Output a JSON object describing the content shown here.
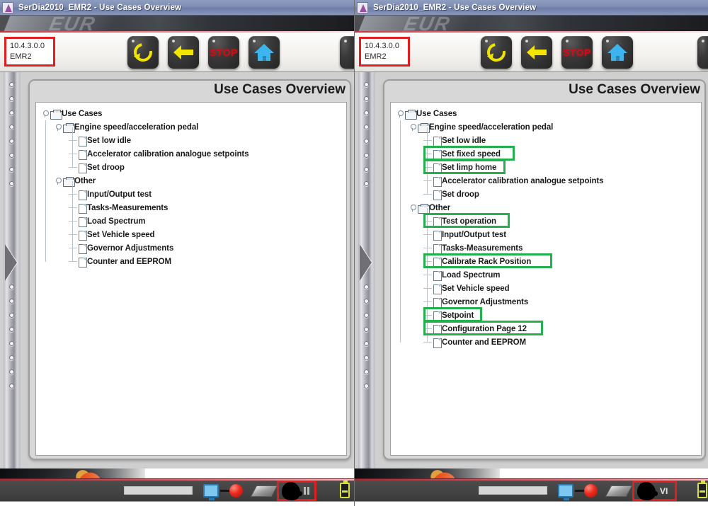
{
  "window": {
    "title": "SerDia2010_EMR2 - Use Cases Overview",
    "app_icon": "app-logo-icon",
    "banner_text": "EUR"
  },
  "toolbar": {
    "version_line1": "10.4.3.0.0",
    "version_line2": "EMR2",
    "version_box_accent": "#e02020",
    "buttons": [
      {
        "name": "refresh-button",
        "icon": "refresh-circular-arrow-icon",
        "label": ""
      },
      {
        "name": "back-button",
        "icon": "left-arrow-icon",
        "label": ""
      },
      {
        "name": "stop-button",
        "icon": "stop-icon",
        "label": "STOP"
      },
      {
        "name": "home-button",
        "icon": "home-icon",
        "label": ""
      }
    ]
  },
  "panel": {
    "heading": "Use Cases Overview",
    "heading_visible": "Use"
  },
  "tree_left": {
    "nodes": [
      {
        "level": 0,
        "type": "folder",
        "label": "Use Cases",
        "expanded": true,
        "highlighted": false
      },
      {
        "level": 1,
        "type": "folder",
        "label": "Engine speed/acceleration pedal",
        "expanded": true,
        "highlighted": false
      },
      {
        "level": 2,
        "type": "file",
        "label": "Set low idle",
        "highlighted": false
      },
      {
        "level": 2,
        "type": "file",
        "label": "Accelerator calibration analogue setpoints",
        "highlighted": false
      },
      {
        "level": 2,
        "type": "file",
        "label": "Set droop",
        "highlighted": false
      },
      {
        "level": 1,
        "type": "folder",
        "label": "Other",
        "expanded": true,
        "highlighted": false
      },
      {
        "level": 2,
        "type": "file",
        "label": "Input/Output test",
        "highlighted": false
      },
      {
        "level": 2,
        "type": "file",
        "label": "Tasks-Measurements",
        "highlighted": false
      },
      {
        "level": 2,
        "type": "file",
        "label": "Load Spectrum",
        "highlighted": false
      },
      {
        "level": 2,
        "type": "file",
        "label": "Set Vehicle speed",
        "highlighted": false
      },
      {
        "level": 2,
        "type": "file",
        "label": "Governor Adjustments",
        "highlighted": false
      },
      {
        "level": 2,
        "type": "file",
        "label": "Counter and EEPROM",
        "highlighted": false
      }
    ]
  },
  "tree_right": {
    "highlight_color": "#22b14c",
    "nodes": [
      {
        "level": 0,
        "type": "folder",
        "label": "Use Cases",
        "expanded": true,
        "highlighted": false
      },
      {
        "level": 1,
        "type": "folder",
        "label": "Engine speed/acceleration pedal",
        "expanded": true,
        "highlighted": false
      },
      {
        "level": 2,
        "type": "file",
        "label": "Set low idle",
        "highlighted": false
      },
      {
        "level": 2,
        "type": "file",
        "label": "Set fixed speed",
        "highlighted": true
      },
      {
        "level": 2,
        "type": "file",
        "label": "Set limp home",
        "highlighted": true
      },
      {
        "level": 2,
        "type": "file",
        "label": "Accelerator calibration analogue setpoints",
        "highlighted": false
      },
      {
        "level": 2,
        "type": "file",
        "label": "Set droop",
        "highlighted": false
      },
      {
        "level": 1,
        "type": "folder",
        "label": "Other",
        "expanded": true,
        "highlighted": false
      },
      {
        "level": 2,
        "type": "file",
        "label": "Test operation",
        "highlighted": true
      },
      {
        "level": 2,
        "type": "file",
        "label": "Input/Output test",
        "highlighted": false
      },
      {
        "level": 2,
        "type": "file",
        "label": "Tasks-Measurements",
        "highlighted": false
      },
      {
        "level": 2,
        "type": "file",
        "label": "Calibrate Rack Position",
        "highlighted": true
      },
      {
        "level": 2,
        "type": "file",
        "label": "Load Spectrum",
        "highlighted": false
      },
      {
        "level": 2,
        "type": "file",
        "label": "Set Vehicle speed",
        "highlighted": false
      },
      {
        "level": 2,
        "type": "file",
        "label": "Governor Adjustments",
        "highlighted": false
      },
      {
        "level": 2,
        "type": "file",
        "label": "Setpoint",
        "highlighted": true
      },
      {
        "level": 2,
        "type": "file",
        "label": "Configuration Page 12",
        "highlighted": true
      },
      {
        "level": 2,
        "type": "file",
        "label": "Counter and EEPROM",
        "highlighted": false
      }
    ]
  },
  "statusbar_left": {
    "connection_icon": "monitor-connection-icon",
    "record_icon": "red-record-dot-icon",
    "stack_icon": "document-stack-icon",
    "head_icon": "head-silhouette-icon",
    "head_badge": "",
    "pause_icon": "pause-icon",
    "battery_icon": "battery-icon",
    "highlight_color": "#e02020"
  },
  "statusbar_right": {
    "connection_icon": "monitor-connection-icon",
    "record_icon": "red-record-dot-icon",
    "stack_icon": "document-stack-icon",
    "head_icon": "head-silhouette-icon",
    "head_badge": "VI",
    "battery_icon": "battery-icon",
    "highlight_color": "#e02020"
  },
  "splitter": {
    "name": "panel-splitter",
    "arrow": "expand-right-arrow-icon"
  }
}
